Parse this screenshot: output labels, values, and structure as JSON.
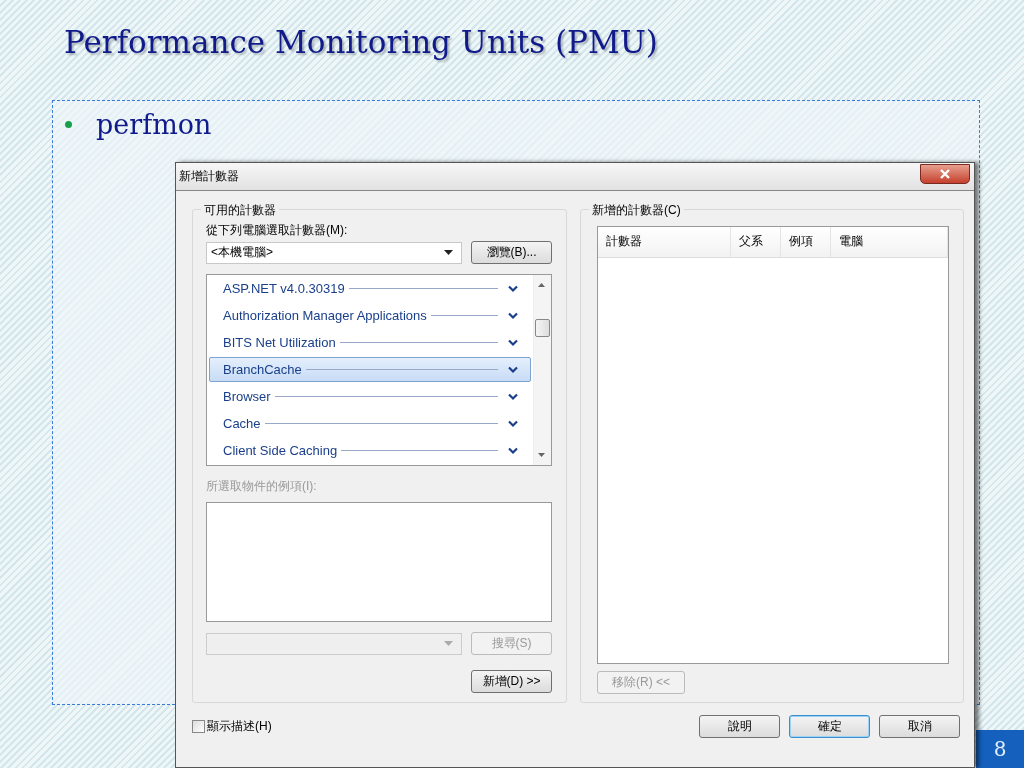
{
  "slide": {
    "title": "Performance Monitoring Units (PMU)",
    "bullets": [
      "perfmon"
    ],
    "page_number": "8"
  },
  "dialog": {
    "title": "新增計數器",
    "available": {
      "label": "可用的計數器",
      "computer_label": "從下列電腦選取計數器(M):",
      "computer_value": "<本機電腦>",
      "browse_button": "瀏覽(B)...",
      "counters": [
        {
          "name": "ASP.NET v4.0.30319",
          "selected": false
        },
        {
          "name": "Authorization Manager Applications",
          "selected": false
        },
        {
          "name": "BITS Net Utilization",
          "selected": false
        },
        {
          "name": "BranchCache",
          "selected": true
        },
        {
          "name": "Browser",
          "selected": false
        },
        {
          "name": "Cache",
          "selected": false
        },
        {
          "name": "Client Side Caching",
          "selected": false
        }
      ],
      "instances": {
        "label": "所選取物件的例項(I):",
        "disabled": true
      },
      "search_button": {
        "label": "搜尋(S)",
        "disabled": true
      },
      "add_button": "新增(D) >>"
    },
    "added": {
      "label": "新增的計數器(C)",
      "columns": [
        "計數器",
        "父系",
        "例項",
        "電腦"
      ],
      "remove_button": {
        "label": "移除(R) <<",
        "disabled": true
      }
    },
    "show_description": {
      "label": "顯示描述(H)",
      "checked": false
    },
    "buttons": [
      {
        "label": "說明",
        "default": false
      },
      {
        "label": "確定",
        "default": true
      },
      {
        "label": "取消",
        "default": false
      }
    ]
  }
}
